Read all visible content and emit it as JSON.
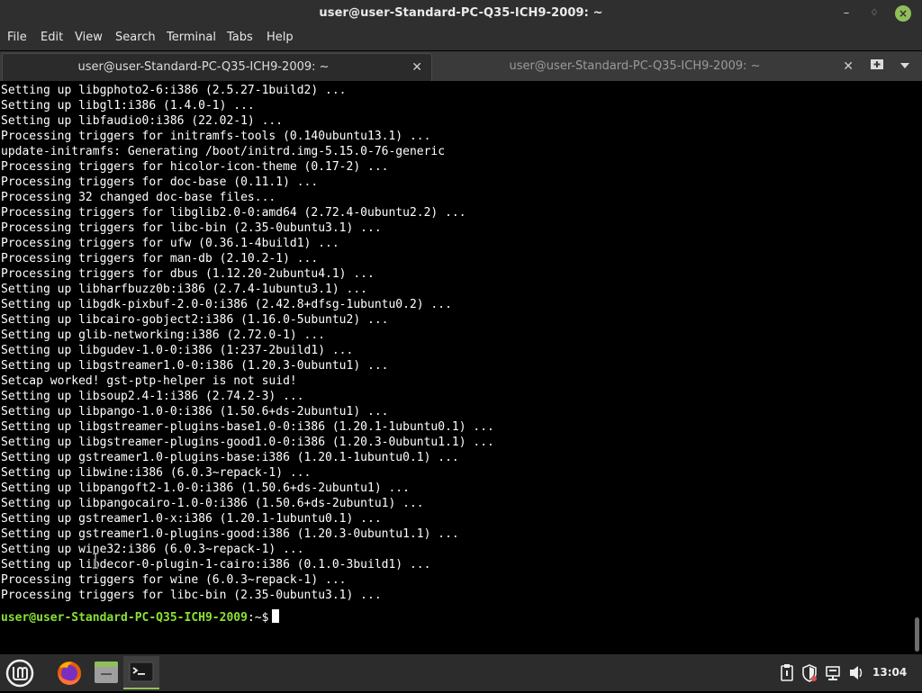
{
  "window": {
    "title": "user@user-Standard-PC-Q35-ICH9-2009: ~"
  },
  "menu": [
    "File",
    "Edit",
    "View",
    "Search",
    "Terminal",
    "Tabs",
    "Help"
  ],
  "tabs": [
    {
      "label": "user@user-Standard-PC-Q35-ICH9-2009: ~",
      "active": true
    },
    {
      "label": "user@user-Standard-PC-Q35-ICH9-2009: ~",
      "active": false
    }
  ],
  "terminal": {
    "lines": [
      "Setting up libgphoto2-6:i386 (2.5.27-1build2) ...",
      "Setting up libgl1:i386 (1.4.0-1) ...",
      "Setting up libfaudio0:i386 (22.02-1) ...",
      "Processing triggers for initramfs-tools (0.140ubuntu13.1) ...",
      "update-initramfs: Generating /boot/initrd.img-5.15.0-76-generic",
      "Processing triggers for hicolor-icon-theme (0.17-2) ...",
      "Processing triggers for doc-base (0.11.1) ...",
      "Processing 32 changed doc-base files...",
      "Processing triggers for libglib2.0-0:amd64 (2.72.4-0ubuntu2.2) ...",
      "Processing triggers for libc-bin (2.35-0ubuntu3.1) ...",
      "Processing triggers for ufw (0.36.1-4build1) ...",
      "Processing triggers for man-db (2.10.2-1) ...",
      "Processing triggers for dbus (1.12.20-2ubuntu4.1) ...",
      "Setting up libharfbuzz0b:i386 (2.7.4-1ubuntu3.1) ...",
      "Setting up libgdk-pixbuf-2.0-0:i386 (2.42.8+dfsg-1ubuntu0.2) ...",
      "Setting up libcairo-gobject2:i386 (1.16.0-5ubuntu2) ...",
      "Setting up glib-networking:i386 (2.72.0-1) ...",
      "Setting up libgudev-1.0-0:i386 (1:237-2build1) ...",
      "Setting up libgstreamer1.0-0:i386 (1.20.3-0ubuntu1) ...",
      "Setcap worked! gst-ptp-helper is not suid!",
      "Setting up libsoup2.4-1:i386 (2.74.2-3) ...",
      "Setting up libpango-1.0-0:i386 (1.50.6+ds-2ubuntu1) ...",
      "Setting up libgstreamer-plugins-base1.0-0:i386 (1.20.1-1ubuntu0.1) ...",
      "Setting up libgstreamer-plugins-good1.0-0:i386 (1.20.3-0ubuntu1.1) ...",
      "Setting up gstreamer1.0-plugins-base:i386 (1.20.1-1ubuntu0.1) ...",
      "Setting up libwine:i386 (6.0.3~repack-1) ...",
      "Setting up libpangoft2-1.0-0:i386 (1.50.6+ds-2ubuntu1) ...",
      "Setting up libpangocairo-1.0-0:i386 (1.50.6+ds-2ubuntu1) ...",
      "Setting up gstreamer1.0-x:i386 (1.20.1-1ubuntu0.1) ...",
      "Setting up gstreamer1.0-plugins-good:i386 (1.20.3-0ubuntu1.1) ...",
      "Setting up wine32:i386 (6.0.3~repack-1) ...",
      "Setting up libdecor-0-plugin-1-cairo:i386 (0.1.0-3build1) ...",
      "Processing triggers for wine (6.0.3~repack-1) ...",
      "Processing triggers for libc-bin (2.35-0ubuntu3.1) ..."
    ],
    "prompt_user": "user@user-Standard-PC-Q35-ICH9-2009",
    "prompt_path": ":~$"
  },
  "taskbar": {
    "clock": "13:04",
    "apps": [
      {
        "icon": "mint-menu-icon"
      },
      {
        "icon": "firefox-icon"
      },
      {
        "icon": "files-icon"
      },
      {
        "icon": "terminal-icon",
        "active": true
      }
    ],
    "tray": [
      "clipboard-icon",
      "shield-icon",
      "network-icon",
      "volume-icon"
    ]
  },
  "colors": {
    "prompt": "#8ae234",
    "accent": "#8fbf5a"
  }
}
